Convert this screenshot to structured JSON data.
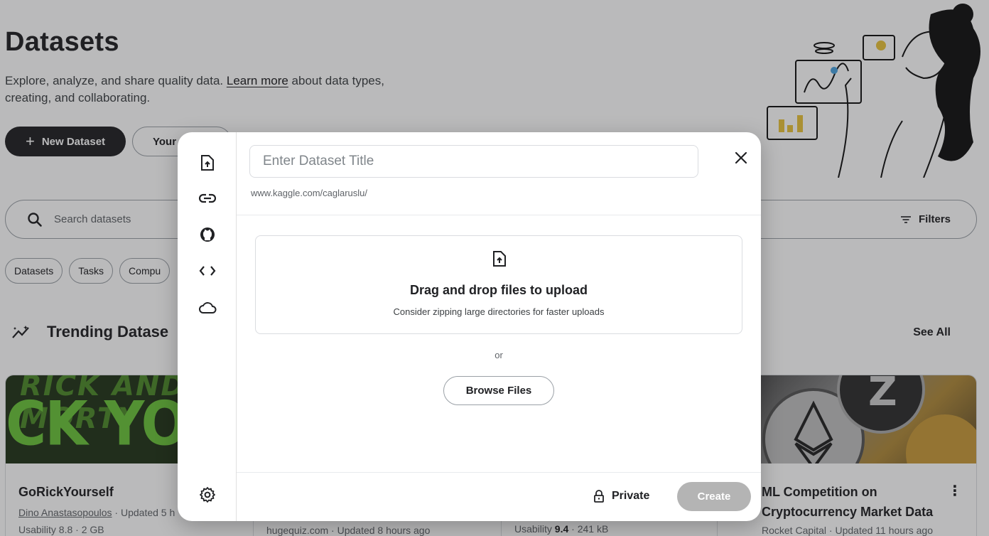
{
  "page": {
    "title": "Datasets",
    "description_before": "Explore, analyze, and share quality data. ",
    "description_link": "Learn more",
    "description_after": " about data types, creating, and collaborating.",
    "new_dataset_label": "New Dataset",
    "your_work_label": "Your",
    "search_placeholder": "Search datasets",
    "filters_label": "Filters",
    "chips": [
      "Datasets",
      "Tasks",
      "Compu"
    ],
    "trending_title": "Trending Datase",
    "see_all_label": "See All"
  },
  "cards": [
    {
      "title": "GoRickYourself",
      "thumb_top_text": "RICK AND MORTY",
      "thumb_text": "CK YOUR",
      "author": "Dino Anastasopoulos",
      "updated": " · Updated 5 h",
      "usability": "Usability 8.8 · 2 GB"
    },
    {
      "meta": "hugequiz.com · Updated 8 hours ago"
    },
    {
      "usability_label": "Usability ",
      "usability_value": "9.4",
      "size": " · 241 kB"
    },
    {
      "title": "ML Competition on Cryptocurrency Market Data",
      "meta": "Rocket Capital · Updated 11 hours ago"
    }
  ],
  "modal": {
    "title_placeholder": "Enter Dataset Title",
    "url_prefix": "www.kaggle.com/caglaruslu/",
    "dropzone_title": "Drag and drop files to upload",
    "dropzone_sub": "Consider zipping large directories for faster uploads",
    "or_text": "or",
    "browse_label": "Browse Files",
    "privacy_label": "Private",
    "create_label": "Create",
    "sidebar_icons": [
      "upload-file-icon",
      "link-icon",
      "github-icon",
      "code-icon",
      "cloud-icon",
      "settings-icon"
    ]
  },
  "colors": {
    "primary_dark": "#202124",
    "overlay": "rgba(32,33,36,0.31)",
    "create_disabled": "#b4b4b4",
    "thumb_green": "#6bc43a"
  }
}
